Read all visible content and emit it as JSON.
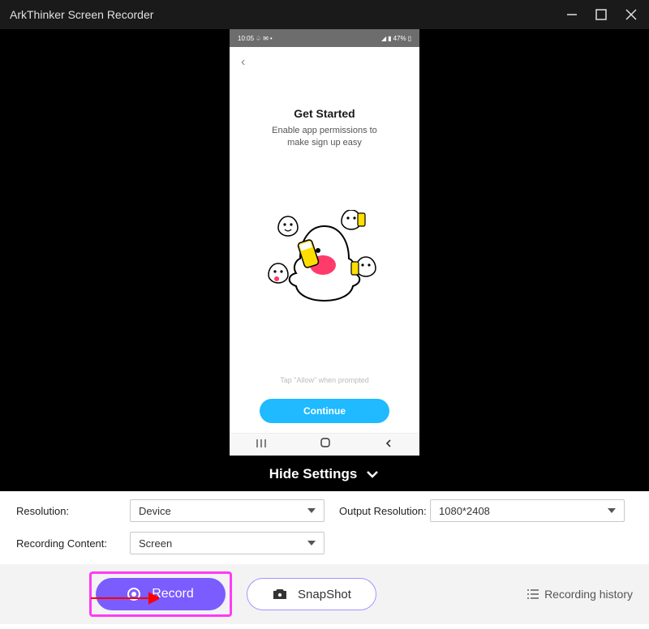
{
  "titlebar": {
    "title": "ArkThinker Screen Recorder"
  },
  "phone": {
    "status_time": "10:05",
    "status_right": "47%",
    "heading": "Get Started",
    "subtitle_line1": "Enable app permissions to",
    "subtitle_line2": "make sign up easy",
    "hint": "Tap \"Allow\" when prompted",
    "continue_label": "Continue"
  },
  "settings_toggle": {
    "label": "Hide Settings"
  },
  "settings": {
    "resolution_label": "Resolution:",
    "resolution_value": "Device",
    "output_resolution_label": "Output Resolution:",
    "output_resolution_value": "1080*2408",
    "recording_content_label": "Recording Content:",
    "recording_content_value": "Screen"
  },
  "actions": {
    "record_label": "Record",
    "snapshot_label": "SnapShot",
    "history_label": "Recording history"
  }
}
